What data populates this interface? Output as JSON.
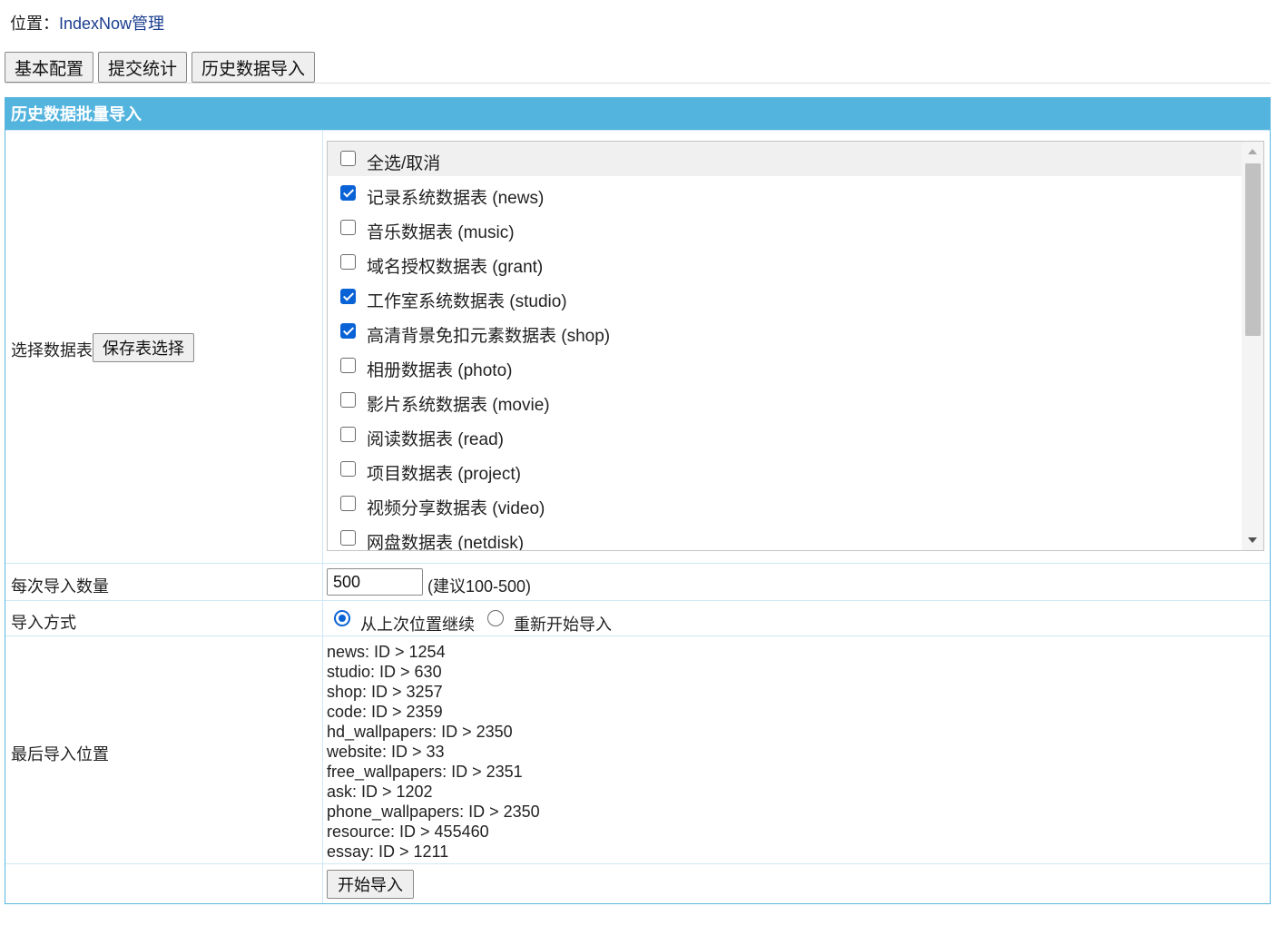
{
  "breadcrumb": {
    "prefix": "位置：",
    "current": "IndexNow管理"
  },
  "tabs": [
    "基本配置",
    "提交统计",
    "历史数据导入"
  ],
  "panel": {
    "title": "历史数据批量导入",
    "select_tables": {
      "label": "选择数据表",
      "save_button": "保存表选择",
      "select_all": "全选/取消",
      "items": [
        {
          "label": "记录系统数据表 (news)",
          "checked": true
        },
        {
          "label": "音乐数据表 (music)",
          "checked": false
        },
        {
          "label": "域名授权数据表 (grant)",
          "checked": false
        },
        {
          "label": "工作室系统数据表 (studio)",
          "checked": true
        },
        {
          "label": "高清背景免扣元素数据表 (shop)",
          "checked": true
        },
        {
          "label": "相册数据表 (photo)",
          "checked": false
        },
        {
          "label": "影片系统数据表 (movie)",
          "checked": false
        },
        {
          "label": "阅读数据表 (read)",
          "checked": false
        },
        {
          "label": "项目数据表 (project)",
          "checked": false
        },
        {
          "label": "视频分享数据表 (video)",
          "checked": false
        },
        {
          "label": "网盘数据表 (netdisk)",
          "checked": false
        }
      ]
    },
    "batch": {
      "label": "每次导入数量",
      "value": "500",
      "hint": "(建议100-500)"
    },
    "mode": {
      "label": "导入方式",
      "option_continue": "从上次位置继续",
      "option_restart": "重新开始导入",
      "selected": "continue"
    },
    "last_position": {
      "label": "最后导入位置",
      "lines": [
        "news: ID > 1254",
        "studio: ID > 630",
        "shop: ID > 3257",
        "code: ID > 2359",
        "hd_wallpapers: ID > 2350",
        "website: ID > 33",
        "free_wallpapers: ID > 2351",
        "ask: ID > 1202",
        "phone_wallpapers: ID > 2350",
        "resource: ID > 455460",
        "essay: ID > 1211"
      ]
    },
    "start_button": "开始导入"
  }
}
